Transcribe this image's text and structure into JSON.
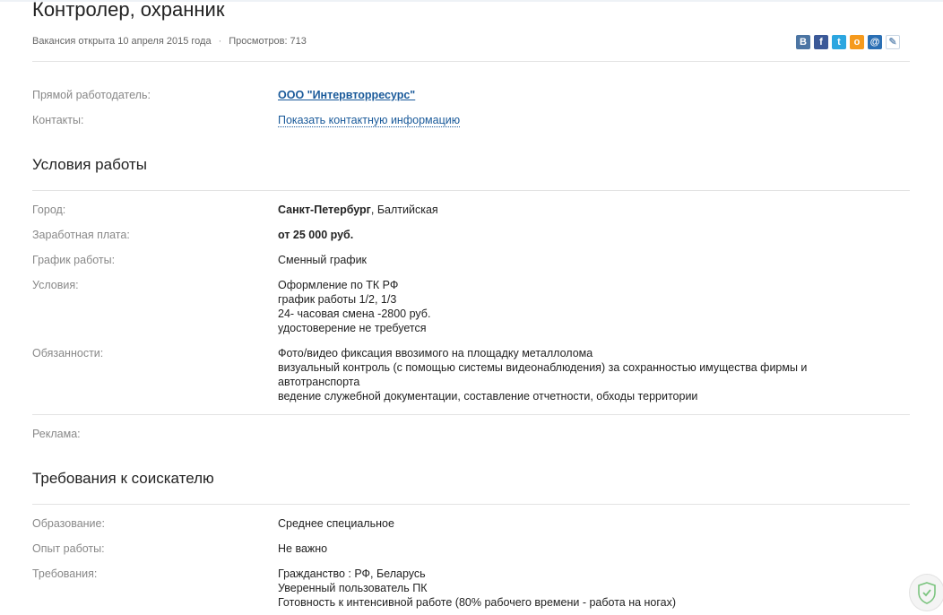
{
  "vacancy": {
    "title": "Контролер, охранник",
    "opened": "Вакансия открыта 10 апреля 2015 года",
    "views": "Просмотров: 713"
  },
  "share": {
    "icons": [
      {
        "name": "vk-icon",
        "glyph": "B",
        "color": "#4c75a3"
      },
      {
        "name": "facebook-icon",
        "glyph": "f",
        "color": "#3b5998"
      },
      {
        "name": "twitter-icon",
        "glyph": "t",
        "color": "#2ca6e0"
      },
      {
        "name": "odnoklassniki-icon",
        "glyph": "о",
        "color": "#f59a1d"
      },
      {
        "name": "mail-icon",
        "glyph": "@",
        "color": "#2a6fb4"
      },
      {
        "name": "livejournal-icon",
        "glyph": "✎",
        "color": "#7a9bbf"
      }
    ]
  },
  "employer": {
    "label": "Прямой работодатель:",
    "name": "ООО \"Интервторресурс\"",
    "contacts_label": "Контакты:",
    "contacts_link": "Показать контактную информацию"
  },
  "conditions": {
    "heading": "Условия работы",
    "city_label": "Город:",
    "city": "Санкт-Петербург",
    "metro": ", Балтийская",
    "salary_label": "Заработная плата:",
    "salary": "от 25 000 руб.",
    "schedule_label": "График работы:",
    "schedule": "Сменный график",
    "terms_label": "Условия:",
    "terms": [
      "Оформление по ТК РФ",
      "график работы 1/2, 1/3",
      "24- часовая смена -2800 руб.",
      "удостоверение не требуется"
    ],
    "duties_label": "Обязанности:",
    "duties": [
      "Фото/видео фиксация ввозимого на площадку металлолома",
      "визуальный контроль (с помощью системы видеонаблюдения) за сохранностью имущества фирмы и",
      "автотранспорта",
      "ведение служебной документации, составление отчетности, обходы территории"
    ],
    "ads_label": "Реклама:"
  },
  "requirements": {
    "heading": "Требования к соискателю",
    "education_label": "Образование:",
    "education": "Среднее специальное",
    "experience_label": "Опыт работы:",
    "experience": "Не важно",
    "reqs_label": "Требования:",
    "reqs": [
      "Гражданство : РФ, Беларусь",
      "Уверенный пользователь ПК",
      "Готовность к интенсивной работе (80% рабочего времени - работа на ногах)"
    ]
  }
}
